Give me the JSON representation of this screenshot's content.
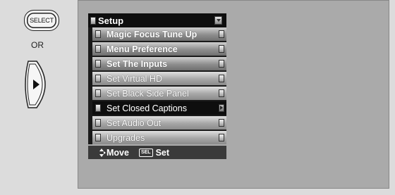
{
  "remote": {
    "select_label": "SELECT",
    "or_label": "OR",
    "right_key_icon": "right-arrow-key-icon"
  },
  "menu": {
    "title": "Setup",
    "items": [
      {
        "label": "Magic Focus Tune Up",
        "state": "normal"
      },
      {
        "label": "Menu Preference",
        "state": "normal"
      },
      {
        "label": "Set The Inputs",
        "state": "normal"
      },
      {
        "label": "Set Virtual HD",
        "state": "light"
      },
      {
        "label": "Set Black Side Panel",
        "state": "light"
      },
      {
        "label": "Set Closed Captions",
        "state": "selected"
      },
      {
        "label": "Set Audio Out",
        "state": "light"
      },
      {
        "label": "Upgrades",
        "state": "light"
      }
    ],
    "footer": {
      "move_label": "Move",
      "sel_key": "SEL",
      "set_label": "Set"
    }
  },
  "colors": {
    "selected_bg": "#0e0e0e",
    "screen_bg": "#aaaaaa"
  }
}
